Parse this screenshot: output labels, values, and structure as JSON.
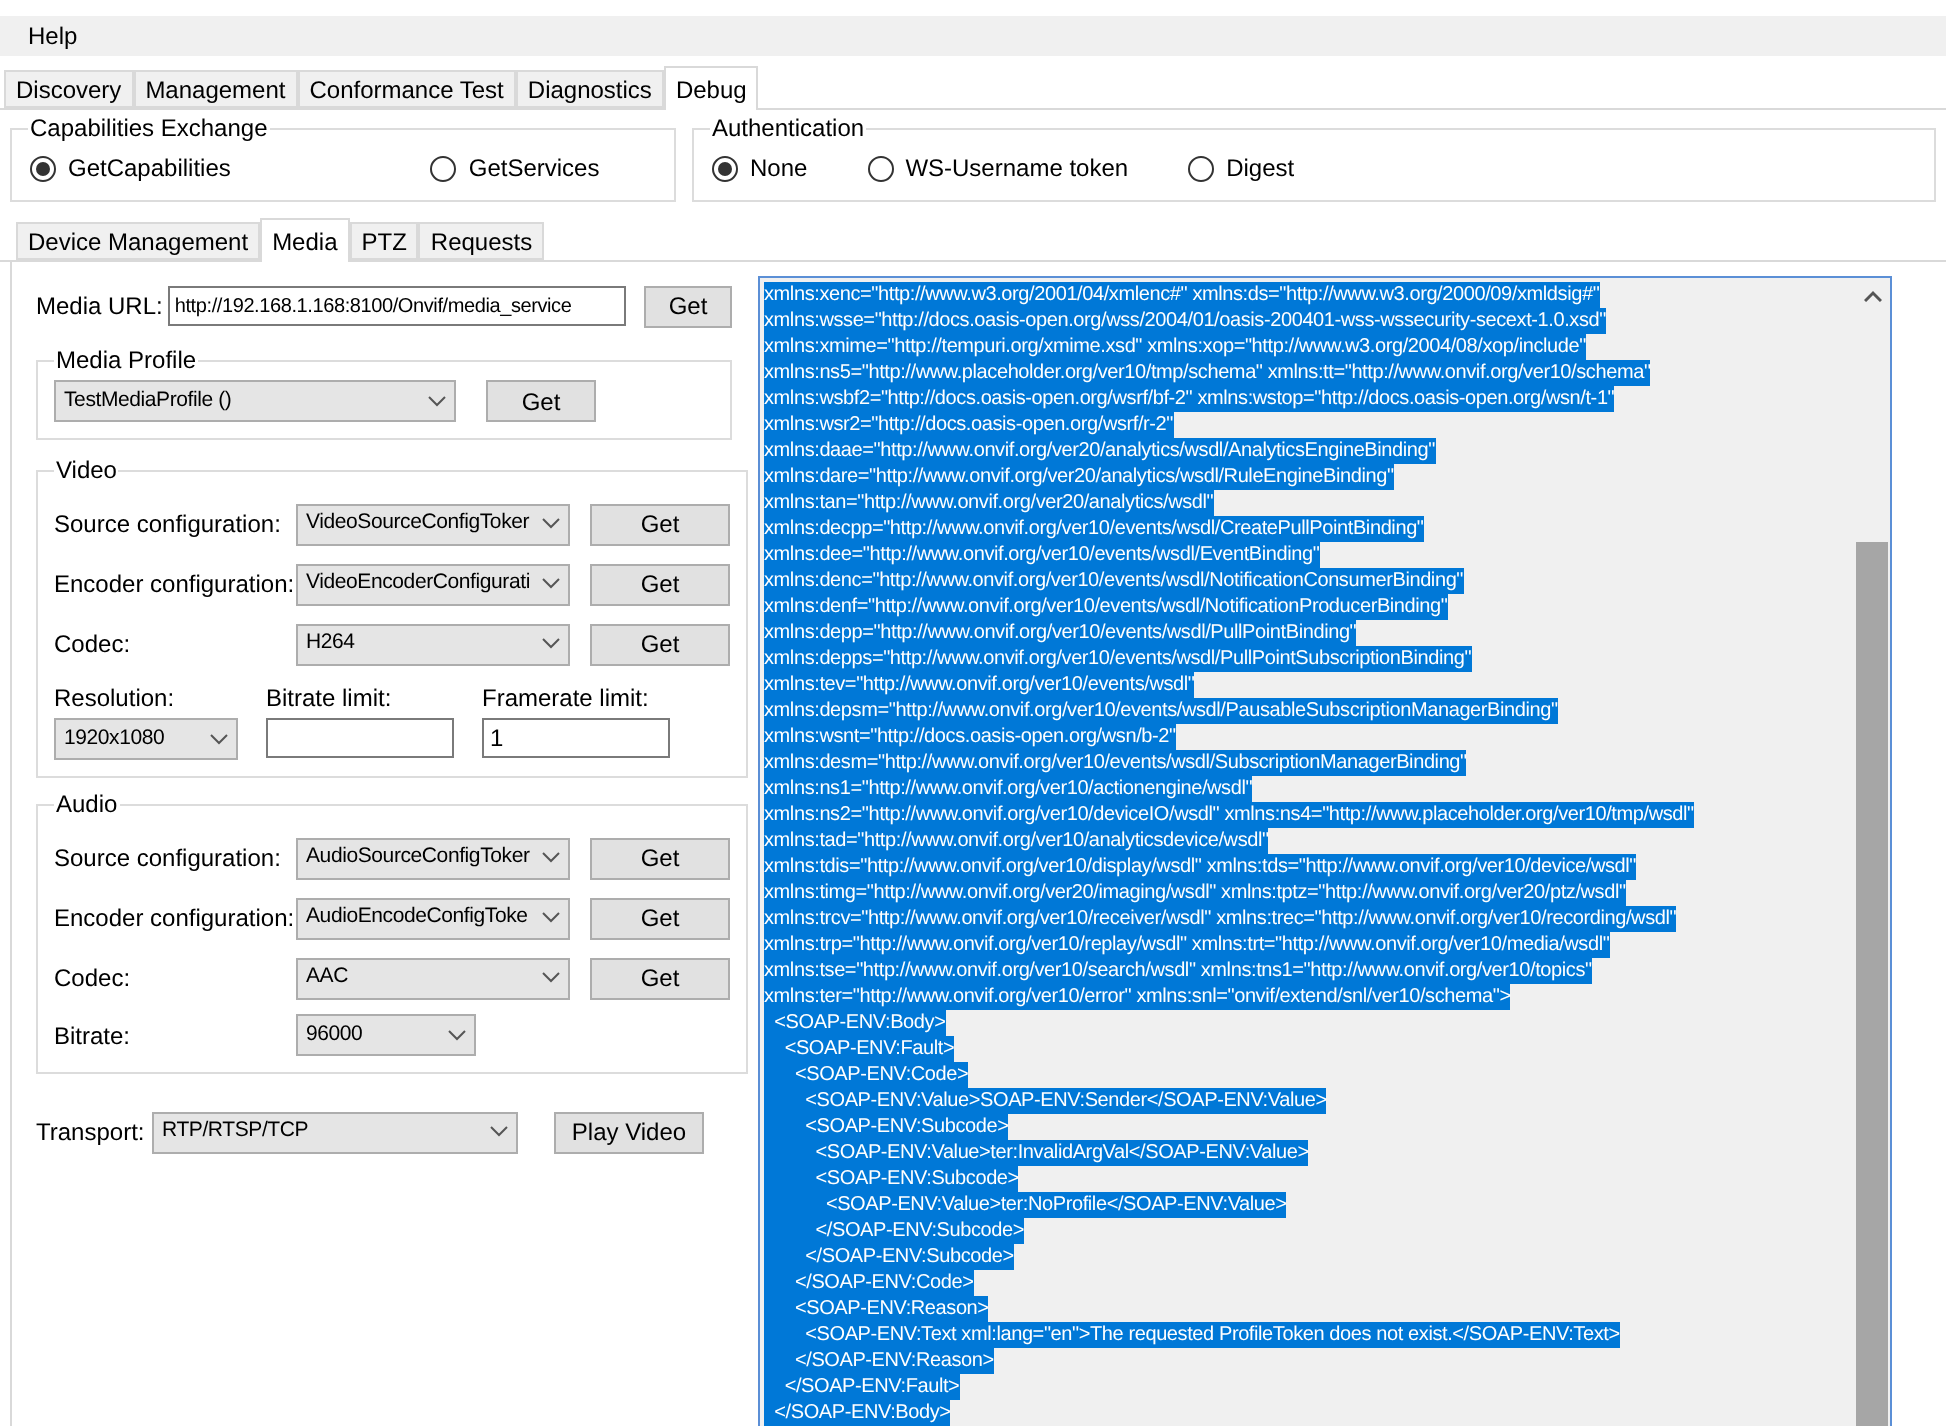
{
  "menu": [
    "Help"
  ],
  "tabs": [
    {
      "label": "Discovery",
      "selected": false
    },
    {
      "label": "Management",
      "selected": false
    },
    {
      "label": "Conformance Test",
      "selected": false
    },
    {
      "label": "Diagnostics",
      "selected": false
    },
    {
      "label": "Debug",
      "selected": true
    }
  ],
  "capabilities": {
    "title": "Capabilities Exchange",
    "options": [
      {
        "label": "GetCapabilities",
        "selected": true
      },
      {
        "label": "GetServices",
        "selected": false
      }
    ]
  },
  "authentication": {
    "title": "Authentication",
    "options": [
      {
        "label": "None",
        "selected": true
      },
      {
        "label": "WS-Username token",
        "selected": false
      },
      {
        "label": "Digest",
        "selected": false
      }
    ]
  },
  "subtabs": [
    {
      "label": "Device Management",
      "selected": false
    },
    {
      "label": "Media",
      "selected": true
    },
    {
      "label": "PTZ",
      "selected": false
    },
    {
      "label": "Requests",
      "selected": false
    }
  ],
  "media_url": {
    "label": "Media URL:",
    "value": "http://192.168.1.168:8100/Onvif/media_service",
    "button": "Get"
  },
  "media_profile": {
    "title": "Media Profile",
    "value": "TestMediaProfile ()",
    "button": "Get"
  },
  "video": {
    "title": "Video",
    "rows": [
      {
        "label": "Source configuration:",
        "value": "VideoSourceConfigToker",
        "button": "Get"
      },
      {
        "label": "Encoder configuration:",
        "value": "VideoEncoderConfigurati",
        "button": "Get"
      },
      {
        "label": "Codec:",
        "value": "H264",
        "button": "Get"
      }
    ],
    "resolution": {
      "label": "Resolution:",
      "value": "1920x1080"
    },
    "bitrate_limit": {
      "label": "Bitrate limit:"
    },
    "framerate_limit": {
      "label": "Framerate limit:",
      "value": "1"
    }
  },
  "audio": {
    "title": "Audio",
    "rows": [
      {
        "label": "Source configuration:",
        "value": "AudioSourceConfigToker",
        "button": "Get"
      },
      {
        "label": "Encoder configuration:",
        "value": "AudioEncodeConfigToke",
        "button": "Get"
      },
      {
        "label": "Codec:",
        "value": "AAC",
        "button": "Get"
      }
    ],
    "bitrate": {
      "label": "Bitrate:",
      "value": "96000"
    }
  },
  "transport": {
    "label": "Transport:",
    "value": "RTP/RTSP/TCP",
    "button": "Play Video"
  },
  "response_lines": [
    "xmlns:xenc=\"http://www.w3.org/2001/04/xmlenc#\" xmlns:ds=\"http://www.w3.org/2000/09/xmldsig#\"",
    "xmlns:wsse=\"http://docs.oasis-open.org/wss/2004/01/oasis-200401-wss-wssecurity-secext-1.0.xsd\"",
    "xmlns:xmime=\"http://tempuri.org/xmime.xsd\" xmlns:xop=\"http://www.w3.org/2004/08/xop/include\"",
    "xmlns:ns5=\"http://www.placeholder.org/ver10/tmp/schema\" xmlns:tt=\"http://www.onvif.org/ver10/schema\"",
    "xmlns:wsbf2=\"http://docs.oasis-open.org/wsrf/bf-2\" xmlns:wstop=\"http://docs.oasis-open.org/wsn/t-1\"",
    "xmlns:wsr2=\"http://docs.oasis-open.org/wsrf/r-2\"",
    "xmlns:daae=\"http://www.onvif.org/ver20/analytics/wsdl/AnalyticsEngineBinding\"",
    "xmlns:dare=\"http://www.onvif.org/ver20/analytics/wsdl/RuleEngineBinding\"",
    "xmlns:tan=\"http://www.onvif.org/ver20/analytics/wsdl\"",
    "xmlns:decpp=\"http://www.onvif.org/ver10/events/wsdl/CreatePullPointBinding\"",
    "xmlns:dee=\"http://www.onvif.org/ver10/events/wsdl/EventBinding\"",
    "xmlns:denc=\"http://www.onvif.org/ver10/events/wsdl/NotificationConsumerBinding\"",
    "xmlns:denf=\"http://www.onvif.org/ver10/events/wsdl/NotificationProducerBinding\"",
    "xmlns:depp=\"http://www.onvif.org/ver10/events/wsdl/PullPointBinding\"",
    "xmlns:depps=\"http://www.onvif.org/ver10/events/wsdl/PullPointSubscriptionBinding\"",
    "xmlns:tev=\"http://www.onvif.org/ver10/events/wsdl\"",
    "xmlns:depsm=\"http://www.onvif.org/ver10/events/wsdl/PausableSubscriptionManagerBinding\"",
    "xmlns:wsnt=\"http://docs.oasis-open.org/wsn/b-2\"",
    "xmlns:desm=\"http://www.onvif.org/ver10/events/wsdl/SubscriptionManagerBinding\"",
    "xmlns:ns1=\"http://www.onvif.org/ver10/actionengine/wsdl\"",
    "xmlns:ns2=\"http://www.onvif.org/ver10/deviceIO/wsdl\" xmlns:ns4=\"http://www.placeholder.org/ver10/tmp/wsdl\"",
    "xmlns:tad=\"http://www.onvif.org/ver10/analyticsdevice/wsdl\"",
    "xmlns:tdis=\"http://www.onvif.org/ver10/display/wsdl\" xmlns:tds=\"http://www.onvif.org/ver10/device/wsdl\"",
    "xmlns:timg=\"http://www.onvif.org/ver20/imaging/wsdl\" xmlns:tptz=\"http://www.onvif.org/ver20/ptz/wsdl\"",
    "xmlns:trcv=\"http://www.onvif.org/ver10/receiver/wsdl\" xmlns:trec=\"http://www.onvif.org/ver10/recording/wsdl\"",
    "xmlns:trp=\"http://www.onvif.org/ver10/replay/wsdl\" xmlns:trt=\"http://www.onvif.org/ver10/media/wsdl\"",
    "xmlns:tse=\"http://www.onvif.org/ver10/search/wsdl\" xmlns:tns1=\"http://www.onvif.org/ver10/topics\"",
    "xmlns:ter=\"http://www.onvif.org/ver10/error\" xmlns:snl=\"onvif/extend/snl/ver10/schema\">",
    "  <SOAP-ENV:Body>",
    "    <SOAP-ENV:Fault>",
    "      <SOAP-ENV:Code>",
    "        <SOAP-ENV:Value>SOAP-ENV:Sender</SOAP-ENV:Value>",
    "        <SOAP-ENV:Subcode>",
    "          <SOAP-ENV:Value>ter:InvalidArgVal</SOAP-ENV:Value>",
    "          <SOAP-ENV:Subcode>",
    "            <SOAP-ENV:Value>ter:NoProfile</SOAP-ENV:Value>",
    "          </SOAP-ENV:Subcode>",
    "        </SOAP-ENV:Subcode>",
    "      </SOAP-ENV:Code>",
    "      <SOAP-ENV:Reason>",
    "        <SOAP-ENV:Text xml:lang=\"en\">The requested ProfileToken does not exist.</SOAP-ENV:Text>",
    "      </SOAP-ENV:Reason>",
    "    </SOAP-ENV:Fault>",
    "  </SOAP-ENV:Body>"
  ]
}
